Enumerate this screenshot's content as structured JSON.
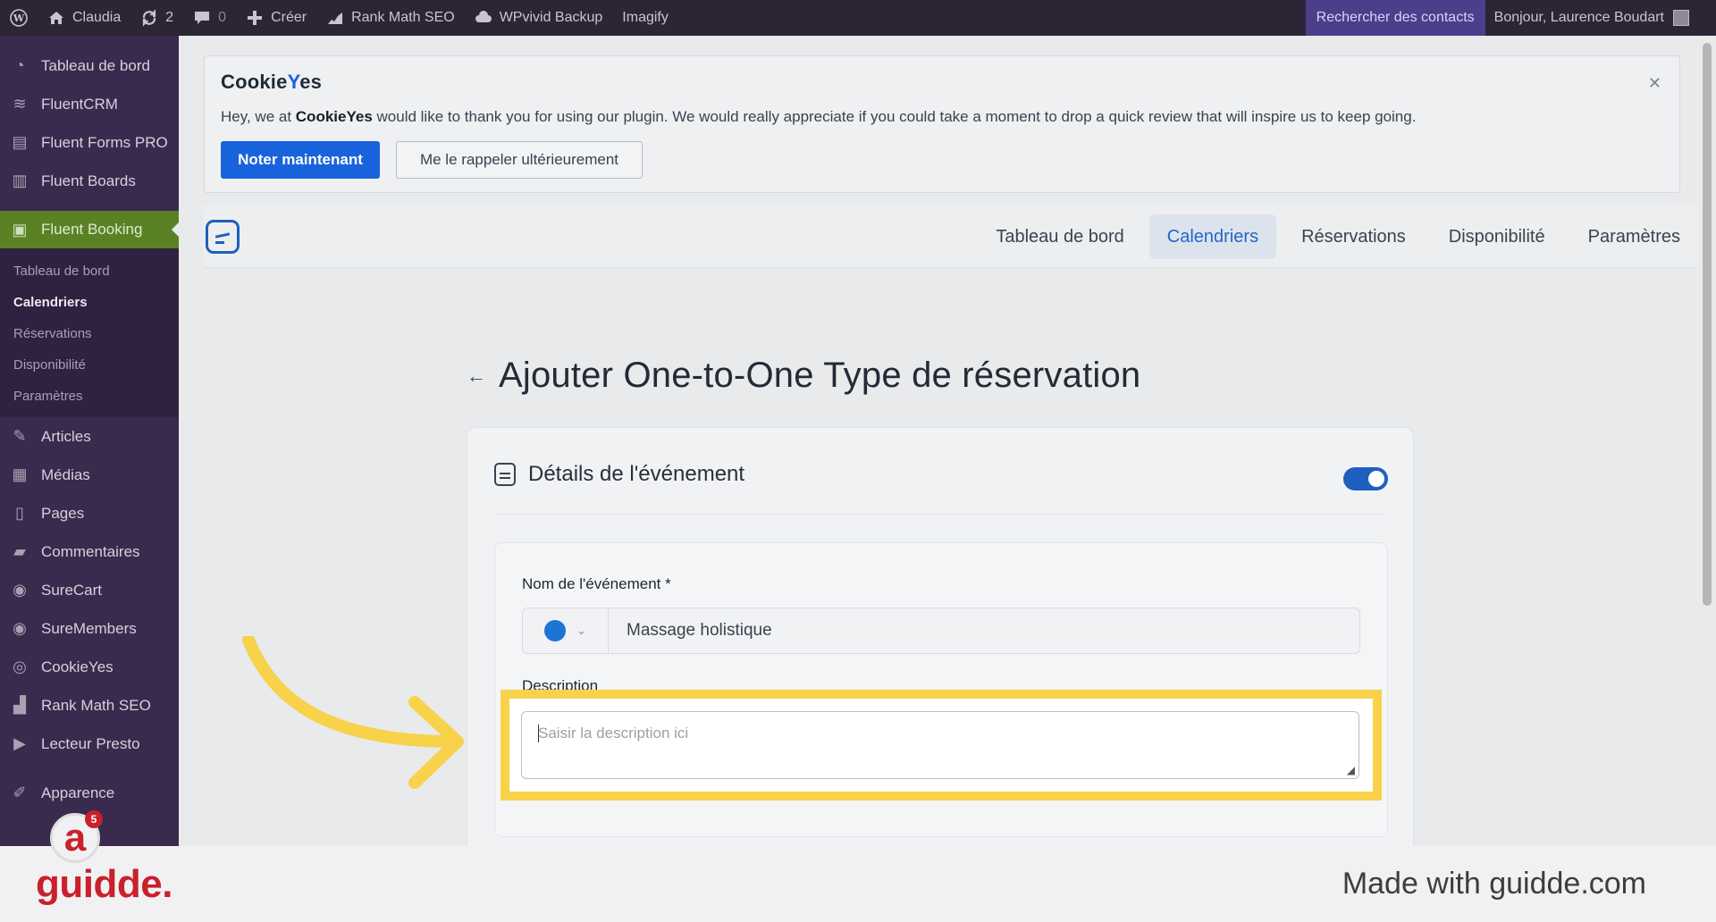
{
  "adminbar": {
    "site_name": "Claudia",
    "updates_count": "2",
    "comments_count": "0",
    "create_label": "Créer",
    "rankmath_label": "Rank Math SEO",
    "wpvivid_label": "WPvivid Backup",
    "imagify_label": "Imagify",
    "search_contacts": "Rechercher des contacts",
    "greeting": "Bonjour, Laurence Boudart"
  },
  "sidebar": {
    "items_top": [
      {
        "label": "Tableau de bord",
        "icon": "dashboard-icon"
      },
      {
        "label": "FluentCRM",
        "icon": "fluentcrm-icon"
      },
      {
        "label": "Fluent Forms PRO",
        "icon": "forms-icon"
      },
      {
        "label": "Fluent Boards",
        "icon": "boards-icon"
      }
    ],
    "active": {
      "label": "Fluent Booking",
      "icon": "booking-icon"
    },
    "submenu": [
      "Tableau de bord",
      "Calendriers",
      "Réservations",
      "Disponibilité",
      "Paramètres"
    ],
    "items_bottom": [
      {
        "label": "Articles",
        "icon": "pin-icon"
      },
      {
        "label": "Médias",
        "icon": "media-icon"
      },
      {
        "label": "Pages",
        "icon": "pages-icon"
      },
      {
        "label": "Commentaires",
        "icon": "comment-icon"
      },
      {
        "label": "SureCart",
        "icon": "surecart-icon"
      },
      {
        "label": "SureMembers",
        "icon": "suremembers-icon"
      },
      {
        "label": "CookieYes",
        "icon": "cookieyes-icon"
      },
      {
        "label": "Rank Math SEO",
        "icon": "rankmath-icon"
      },
      {
        "label": "Lecteur Presto",
        "icon": "presto-icon"
      }
    ],
    "appearance": "Apparence"
  },
  "notice": {
    "logo_pre": "Cookie",
    "logo_y": "Y",
    "logo_post": "es",
    "text_pre": "Hey, we at ",
    "text_brand": "CookieYes",
    "text_post": " would like to thank you for using our plugin. We would really appreciate if you could take a moment to drop a quick review that will inspire us to keep going.",
    "primary_button": "Noter maintenant",
    "secondary_button": "Me le rappeler ultérieurement"
  },
  "plugin_nav": {
    "tabs": [
      "Tableau de bord",
      "Calendriers",
      "Réservations",
      "Disponibilité",
      "Paramètres"
    ]
  },
  "page": {
    "title": "Ajouter One-to-One Type de réservation"
  },
  "event_card": {
    "title": "Détails de l'événement",
    "name_label": "Nom de l'événement *",
    "name_value": "Massage holistique",
    "color": "#1c74d4",
    "description_label": "Description",
    "description_placeholder": "Saisir la description ici"
  },
  "footer": {
    "logo": "guidde.",
    "made_with": "Made with guidde.com",
    "badge_count": "5"
  },
  "colors": {
    "admin_bar": "#2c2536",
    "sidebar": "#3a2a4d",
    "active_menu": "#5a8224",
    "primary": "#1863dc",
    "highlight": "#f7d24a",
    "guidde_red": "#c9202c"
  }
}
